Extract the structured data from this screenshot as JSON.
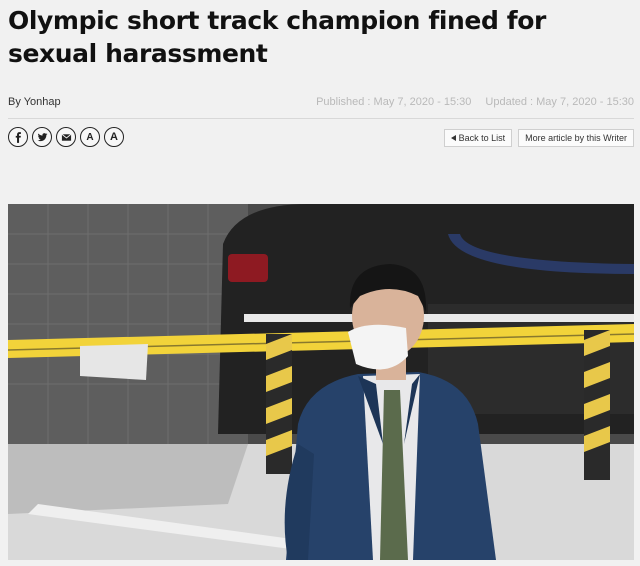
{
  "article": {
    "headline": "Olympic short track champion fined for sexual harassment",
    "byline": "By Yonhap",
    "published": "Published : May 7, 2020 - 15:30",
    "updated": "Updated : May 7, 2020 - 15:30"
  },
  "share": {
    "facebook_icon": "facebook-icon",
    "twitter_icon": "twitter-icon",
    "email_icon": "email-icon",
    "font_smaller": "A",
    "font_larger": "A"
  },
  "nav": {
    "back_label": "Back to List",
    "more_label": "More article by this Writer"
  }
}
